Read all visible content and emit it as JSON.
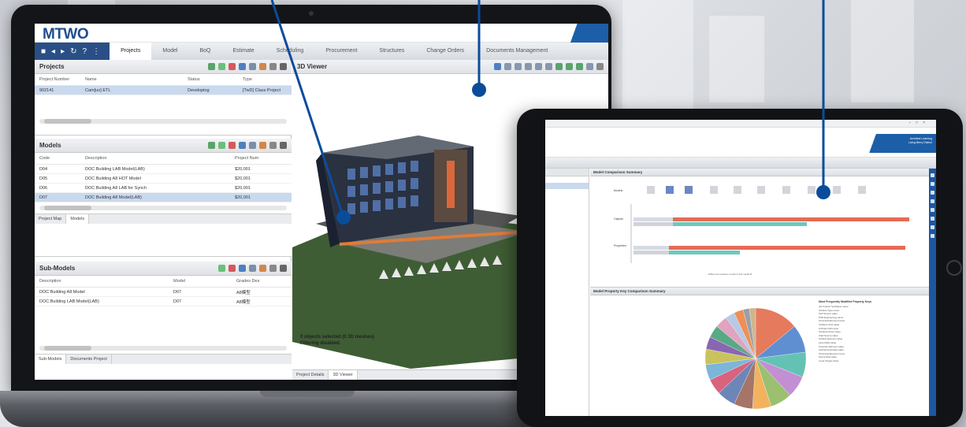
{
  "laptop": {
    "logo": "MTWO",
    "nav_tabs": [
      "Projects",
      "Model",
      "BoQ",
      "Estimate",
      "Scheduling",
      "Procurement",
      "Structures",
      "Change Orders",
      "Documents Management"
    ],
    "projects": {
      "title": "Projects",
      "columns": [
        "Project Number",
        "Name",
        "Status",
        "Type"
      ],
      "rows": [
        [
          "902141",
          "Cam[uo] ETL",
          "Developing",
          "[TwD] Class Project"
        ]
      ]
    },
    "models": {
      "title": "Models",
      "columns": [
        "Code",
        "Description",
        "Project Num"
      ],
      "rows": [
        [
          "D04",
          "DOC Building LAB Model(LAB)",
          "$20,001"
        ],
        [
          "D05",
          "DOC Building A8 HOT Model",
          "$20,001"
        ],
        [
          "D06",
          "DOC Building A8 LAB for Synch",
          "$20,001"
        ],
        [
          "D07",
          "DOC Building A8 Model(LAB)",
          "$20,001"
        ]
      ],
      "tabs": [
        "Project Map",
        "Models"
      ]
    },
    "submodels": {
      "title": "Sub-Models",
      "columns": [
        "Description",
        "Model",
        "Grades Des"
      ],
      "rows": [
        [
          "DOC Building A8 Model",
          "D07",
          "A8模型"
        ],
        [
          "DOC Building LAB Model(LAB)",
          "D07",
          "A8模型"
        ]
      ],
      "tabs": [
        "Sub-Models",
        "Documents Project"
      ]
    },
    "viewer": {
      "title": "3D Viewer",
      "info_line1": "0 objects selected (0 3D meshes)",
      "info_line2": "Filtering disabled.",
      "tabs": [
        "Project Details",
        "3D Viewer"
      ]
    }
  },
  "tablet": {
    "banner_line1": "Architect Learning",
    "banner_line2": "Living Berry District",
    "chart1_title": "Model Comparison Summary",
    "chart1_labels": [
      "Models",
      "Objects",
      "Properties"
    ],
    "chart1_caption": "Difference between model A and model B",
    "chart2_title": "Model Property Key Comparison Summary",
    "legend_title": "Most Frequently Modified Property Keys",
    "legend_items": [
      "uid.Custom.SysWiese.name",
      "Surface.Type.name",
      "Surf.Source.value",
      "PSD.Engineering.name",
      "Structural.Element.name",
      "Surfaces.Text.value",
      "Architect.AR.name",
      "Surfaces.Fixes.value",
      "Clad.Source.value",
      "Surface.Element.value",
      "Lane.Mark.value",
      "Structure.Element.value",
      "Architectural.Data.value",
      "Structural.Element.name",
      "Zones.Mod.value",
      "Level.Integer.value"
    ],
    "pie_slices": [
      14,
      9,
      8,
      7,
      7,
      6,
      6,
      6,
      5,
      5,
      5,
      4,
      4,
      4,
      3,
      3,
      2,
      2
    ],
    "pie_colors": [
      "#e67a5d",
      "#5f8fd1",
      "#64c2b4",
      "#c28fd3",
      "#9ac070",
      "#f2b25e",
      "#a47568",
      "#6d86b8",
      "#d8637d",
      "#7cb6d8",
      "#c9c35d",
      "#8a66b2",
      "#59a985",
      "#e0a3c0",
      "#b7c9e6",
      "#ef8f55",
      "#9aa0a8",
      "#d2b48c"
    ]
  },
  "colors": {
    "brand": "#1f4d8f",
    "nav": "#2a4f86",
    "callout": "#0a4c9c"
  }
}
